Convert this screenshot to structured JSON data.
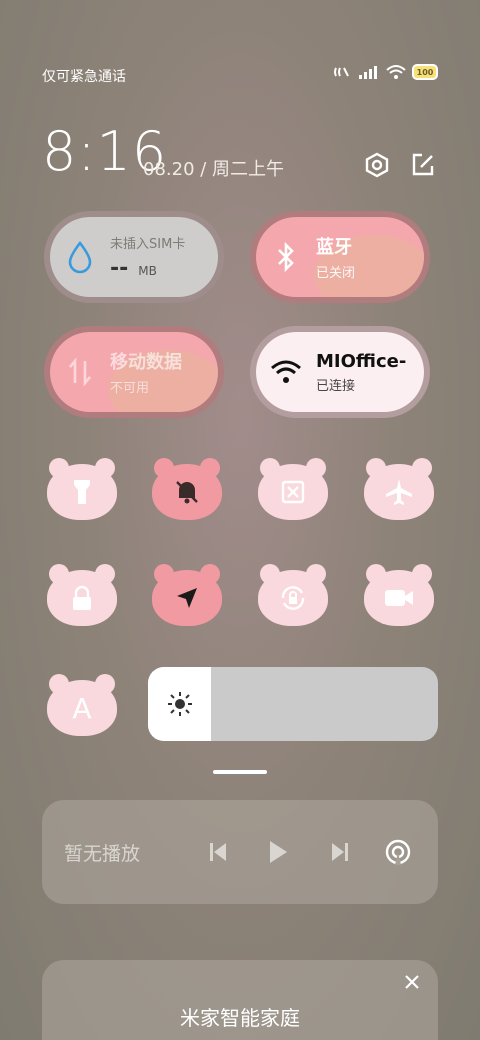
{
  "status_bar": {
    "carrier_text": "仅可紧急通话",
    "battery_level": "100",
    "icons": [
      "nfc-icon",
      "signal-icon",
      "wifi-icon",
      "battery-icon"
    ]
  },
  "header": {
    "time": "8:16",
    "date": "08.20 / 周二上午",
    "icons": [
      "settings-icon",
      "edit-icon"
    ]
  },
  "tiles": {
    "sim": {
      "title": "未插入SIM卡",
      "value": "--",
      "unit": "MB",
      "icon": "water-drop-icon"
    },
    "bluetooth": {
      "title": "蓝牙",
      "status": "已关闭",
      "icon": "bluetooth-icon"
    },
    "mobile_data": {
      "title": "移动数据",
      "status": "不可用",
      "icon": "data-transfer-icon"
    },
    "wifi": {
      "title": "MIOffice-",
      "status": "已连接",
      "icon": "wifi-icon"
    }
  },
  "toggles_row1": [
    "flashlight-icon",
    "silent-bell-icon",
    "screenshot-icon",
    "airplane-icon"
  ],
  "toggles_row2": [
    "lock-icon",
    "location-icon",
    "rotation-lock-icon",
    "video-icon"
  ],
  "font_toggle": {
    "label": "A"
  },
  "brightness": {
    "level": 0.21,
    "icon": "sun-icon"
  },
  "media": {
    "status": "暂无播放"
  },
  "smart_home": {
    "title": "米家智能家庭"
  },
  "colors": {
    "pink": "#f4a7ac",
    "light_pink": "#f9d9de",
    "accent_blue": "#3a9bdc"
  }
}
